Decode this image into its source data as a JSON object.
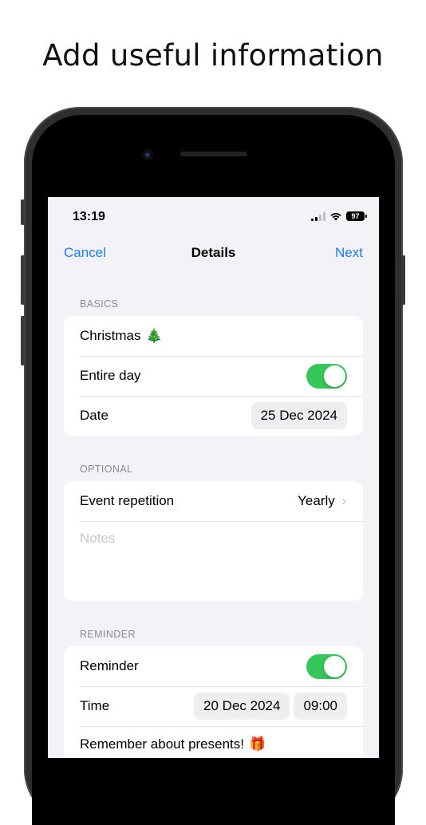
{
  "headline": "Add useful information",
  "status_bar": {
    "time": "13:19",
    "battery": "97"
  },
  "nav": {
    "cancel_label": "Cancel",
    "title": "Details",
    "next_label": "Next"
  },
  "basics": {
    "header": "BASICS",
    "event_name": "Christmas",
    "event_emoji": "🎄",
    "entire_day_label": "Entire day",
    "entire_day_on": true,
    "date_label": "Date",
    "date_value": "25 Dec 2024"
  },
  "optional": {
    "header": "OPTIONAL",
    "repetition_label": "Event repetition",
    "repetition_value": "Yearly",
    "notes_placeholder": "Notes"
  },
  "reminder": {
    "header": "REMINDER",
    "reminder_label": "Reminder",
    "reminder_on": true,
    "time_label": "Time",
    "time_date": "20 Dec 2024",
    "time_value": "09:00",
    "message": "Remember about presents!",
    "message_emoji": "🎁"
  },
  "colors": {
    "accent": "#1a7cf5",
    "toggle_on": "#34c759",
    "background": "#f2f2f7"
  }
}
